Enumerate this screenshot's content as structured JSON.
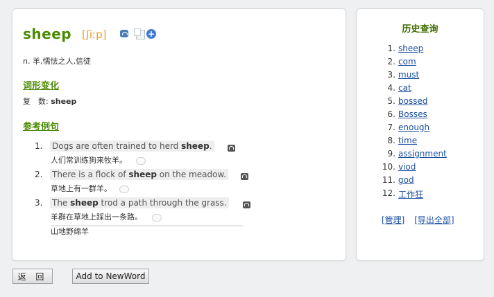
{
  "entry": {
    "word": "sheep",
    "phonetic": "[ʃiːp]",
    "definition": "n. 羊,懦怯之人,信徒"
  },
  "forms": {
    "section_title": "词形变化",
    "label": "复　数:",
    "value": "sheep"
  },
  "examples": {
    "section_title": "参考例句",
    "items": [
      {
        "num": "1.",
        "pre": "Dogs are often trained to herd ",
        "bold": "sheep",
        "post": ".",
        "cn": "人们常训练狗来牧羊。"
      },
      {
        "num": "2.",
        "pre": "There is a flock of ",
        "bold": "sheep",
        "post": " on the meadow.",
        "cn": "草地上有一群羊。"
      },
      {
        "num": "3.",
        "pre": "The ",
        "bold": "sheep",
        "post": " trod a path through the grass.",
        "cn": "羊群在草地上踩出一条路。"
      }
    ],
    "extra": "山地野绵羊"
  },
  "history": {
    "title": "历史查询",
    "items": [
      {
        "num": "1.",
        "word": "sheep"
      },
      {
        "num": "2.",
        "word": "com"
      },
      {
        "num": "3.",
        "word": "must"
      },
      {
        "num": "4.",
        "word": "cat"
      },
      {
        "num": "5.",
        "word": "bossed"
      },
      {
        "num": "6.",
        "word": "Bosses"
      },
      {
        "num": "7.",
        "word": "enough"
      },
      {
        "num": "8.",
        "word": "time"
      },
      {
        "num": "9.",
        "word": "assignment"
      },
      {
        "num": "10.",
        "word": "viod"
      },
      {
        "num": "11.",
        "word": "god"
      },
      {
        "num": "12.",
        "word": "工作狂"
      }
    ],
    "manage_label": "[管理]",
    "export_label": "[导出全部]"
  },
  "buttons": {
    "back_label": "返 回",
    "addword_label": "Add to NewWord"
  },
  "icons": {
    "speaker": "speaker-icon",
    "copy": "copy-icon",
    "add": "add-icon",
    "audio": "audio-icon",
    "comment": "comment-bubble-icon"
  },
  "colors": {
    "accent_green": "#4a8a00",
    "phonetic_orange": "#e89a1c",
    "link_blue": "#1a4fa0"
  }
}
